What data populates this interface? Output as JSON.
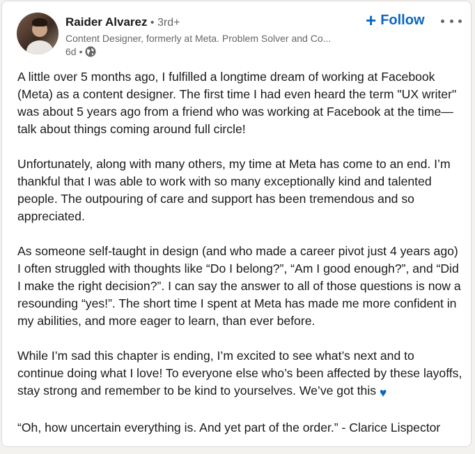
{
  "post": {
    "author": {
      "name": "Raider Alvarez",
      "connection_sep": " • ",
      "degree": "3rd+",
      "headline": "Content Designer, formerly at Meta. Problem Solver and Co...",
      "time": "6d",
      "time_sep": " •"
    },
    "follow": {
      "plus": "+",
      "label": "Follow"
    },
    "more_icon": "ellipsis-icon",
    "paragraphs": [
      "A little over 5 months ago, I fulfilled a longtime dream of working at Facebook (Meta) as a content designer. The first time I had even heard the term \"UX writer\" was about 5 years ago from a friend who was working at Facebook at the time—talk about things coming around full circle!",
      "Unfortunately, along with many others, my time at Meta has come to an end. I’m thankful that I was able to work with so many exceptionally kind and talented people. The outpouring of care and support has been tremendous and so appreciated.",
      "As someone self-taught in design (and who made a career pivot just 4 years ago) I often struggled with thoughts like “Do I belong?”, “Am I good enough?”, and “Did I make the right decision?”. I can say the answer to all of those questions is now a resounding “yes!”. The short time I spent at Meta has made me more confident in my abilities, and more eager to learn, than ever before.",
      "While I’m sad this chapter is ending, I’m excited to see what’s next and to continue doing what I love! To everyone else who’s been affected by these layoffs, stay strong and remember to be kind to yourselves. We’ve got this",
      "“Oh, how uncertain everything is. And yet part of the order.” - Clarice Lispector"
    ],
    "heart": "♥",
    "colors": {
      "accent": "#0a66c2",
      "secondary_text": "#666666",
      "text": "#191919"
    }
  }
}
